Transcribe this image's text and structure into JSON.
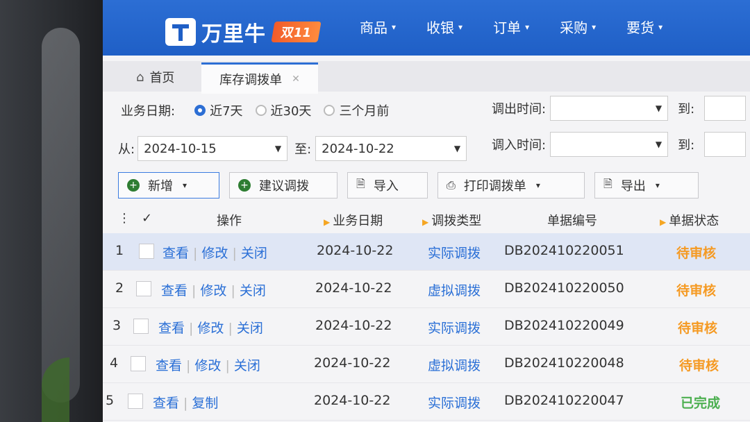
{
  "app": {
    "logo_text": "万里牛",
    "logo_badge": "双11"
  },
  "nav": [
    {
      "label": "商品"
    },
    {
      "label": "收银"
    },
    {
      "label": "订单"
    },
    {
      "label": "采购"
    },
    {
      "label": "要货"
    }
  ],
  "tabs": {
    "home": "首页",
    "active": "库存调拨单"
  },
  "filters": {
    "biz_date_label": "业务日期:",
    "radios": [
      {
        "label": "近7天",
        "checked": true
      },
      {
        "label": "近30天",
        "checked": false
      },
      {
        "label": "三个月前",
        "checked": false
      }
    ],
    "from_label": "从:",
    "from_value": "2024-10-15",
    "to_label": "至:",
    "to_value": "2024-10-22",
    "out_time_label": "调出时间:",
    "in_time_label": "调入时间:",
    "until_label": "到:"
  },
  "toolbar": {
    "add": "新增",
    "suggest": "建议调拨",
    "import": "导入",
    "print": "打印调拨单",
    "export": "导出"
  },
  "table": {
    "headers": {
      "ops": "操作",
      "date": "业务日期",
      "type": "调拨类型",
      "no": "单据编号",
      "status": "单据状态"
    },
    "rows": [
      {
        "idx": "1",
        "ops": [
          "查看",
          "修改",
          "关闭"
        ],
        "date": "2024-10-22",
        "type": "实际调拨",
        "no": "DB202410220051",
        "status": "待审核"
      },
      {
        "idx": "2",
        "ops": [
          "查看",
          "修改",
          "关闭"
        ],
        "date": "2024-10-22",
        "type": "虚拟调拨",
        "no": "DB202410220050",
        "status": "待审核"
      },
      {
        "idx": "3",
        "ops": [
          "查看",
          "修改",
          "关闭"
        ],
        "date": "2024-10-22",
        "type": "实际调拨",
        "no": "DB202410220049",
        "status": "待审核"
      },
      {
        "idx": "4",
        "ops": [
          "查看",
          "修改",
          "关闭"
        ],
        "date": "2024-10-22",
        "type": "虚拟调拨",
        "no": "DB202410220048",
        "status": "待审核"
      },
      {
        "idx": "5",
        "ops": [
          "查看",
          "复制"
        ],
        "date": "2024-10-22",
        "type": "实际调拨",
        "no": "DB202410220047",
        "status": "已完成"
      }
    ]
  },
  "colors": {
    "brand": "#1f5fc6",
    "link": "#2a6fd6",
    "pending": "#f59a23",
    "done": "#4caf50"
  }
}
